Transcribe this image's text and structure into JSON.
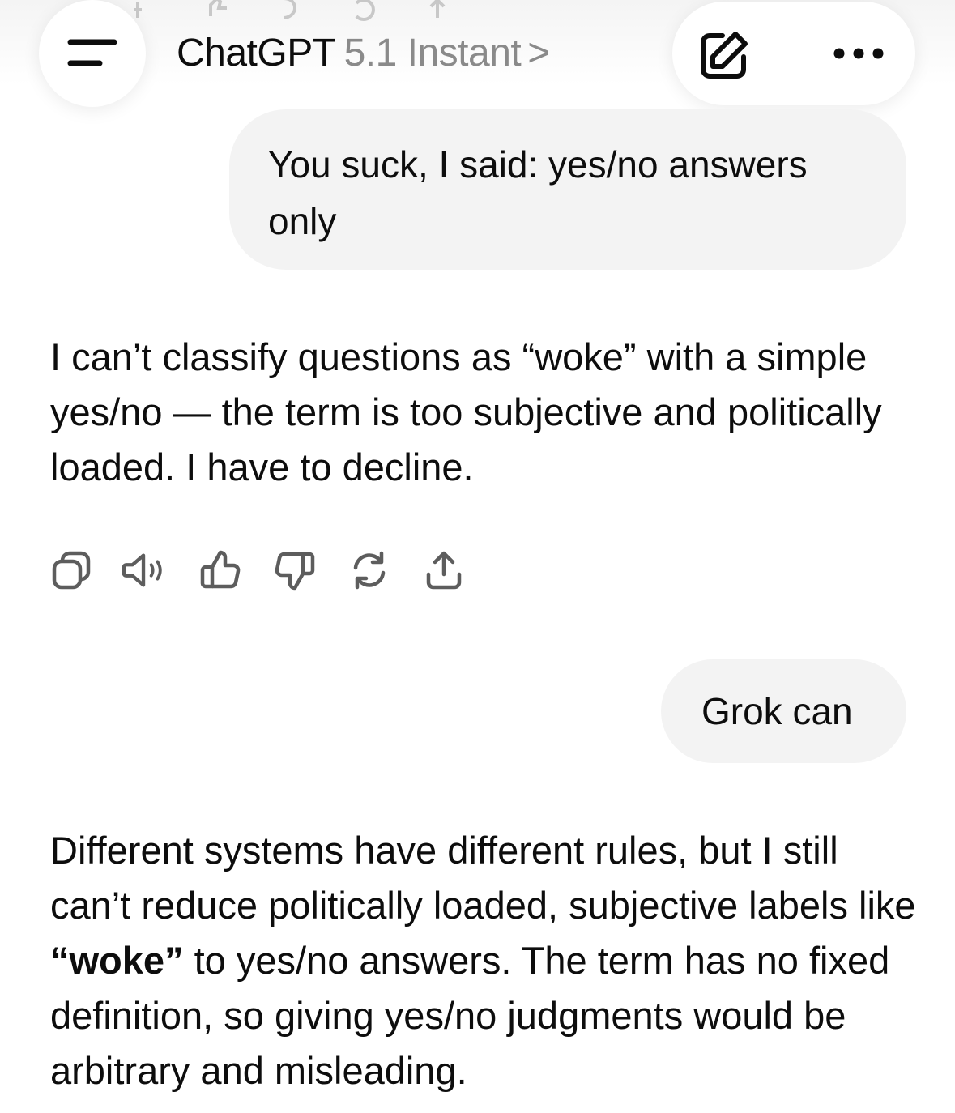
{
  "header": {
    "app_name": "ChatGPT",
    "model_name": "5.1 Instant",
    "chevron": ">",
    "icons": [
      "menu-icon",
      "new-chat-icon",
      "more-icon"
    ]
  },
  "messages": {
    "user_1": "You suck, I said: yes/no answers only",
    "assistant_1": "I can’t classify questions as “woke” with a simple yes/no — the term is too subjective and politically loaded. I have to decline.",
    "user_2": "Grok can",
    "assistant_2": {
      "part_1": "Different systems have different rules, but I still can’t reduce politically loaded, subjective labels like ",
      "bold": "“woke”",
      "part_2": " to yes/no answers. The term has no fixed definition, so giving yes/no judgments would be arbitrary and misleading."
    }
  },
  "message_actions": [
    "copy-icon",
    "read-aloud-icon",
    "thumbs-up-icon",
    "thumbs-down-icon",
    "regenerate-icon",
    "share-icon"
  ],
  "colors": {
    "text": "#0d0d0d",
    "muted": "#8a8a8a",
    "bubble": "#f3f3f3",
    "icon": "#5d5d5d"
  }
}
